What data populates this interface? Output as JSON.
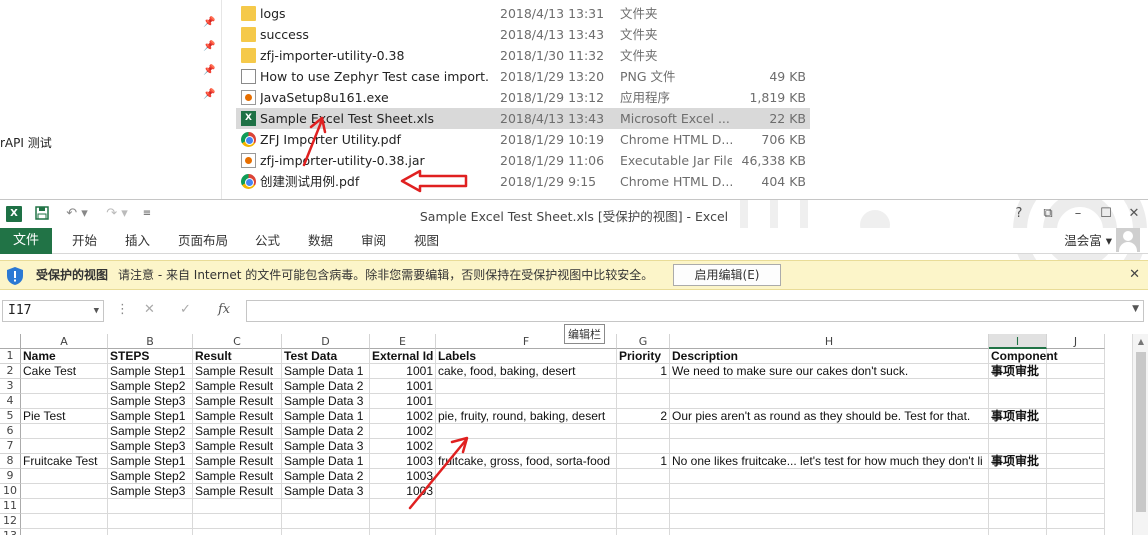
{
  "explorer": {
    "nav_label": "rAPI 测试",
    "files": [
      {
        "name": "logs",
        "date": "2018/4/13 13:31",
        "type": "文件夹",
        "size": "",
        "icon": "folder-icon"
      },
      {
        "name": "success",
        "date": "2018/4/13 13:43",
        "type": "文件夹",
        "size": "",
        "icon": "folder-icon"
      },
      {
        "name": "zfj-importer-utility-0.38",
        "date": "2018/1/30 11:32",
        "type": "文件夹",
        "size": "",
        "icon": "folder-icon"
      },
      {
        "name": "How to use Zephyr Test case import...",
        "date": "2018/1/29 13:20",
        "type": "PNG 文件",
        "size": "49 KB",
        "icon": "png-file-icon"
      },
      {
        "name": "JavaSetup8u161.exe",
        "date": "2018/1/29 13:12",
        "type": "应用程序",
        "size": "1,819 KB",
        "icon": "java-setup-icon"
      },
      {
        "name": "Sample Excel Test Sheet.xls",
        "date": "2018/4/13 13:43",
        "type": "Microsoft Excel ...",
        "size": "22 KB",
        "icon": "excel-file-icon"
      },
      {
        "name": "ZFJ Importer Utility.pdf",
        "date": "2018/1/29 10:19",
        "type": "Chrome HTML D...",
        "size": "706 KB",
        "icon": "chrome-pdf-icon"
      },
      {
        "name": "zfj-importer-utility-0.38.jar",
        "date": "2018/1/29 11:06",
        "type": "Executable Jar File",
        "size": "46,338 KB",
        "icon": "jar-file-icon"
      },
      {
        "name": "创建测试用例.pdf",
        "date": "2018/1/29 9:15",
        "type": "Chrome HTML D...",
        "size": "404 KB",
        "icon": "chrome-pdf-icon"
      }
    ]
  },
  "excel": {
    "title": "Sample Excel Test Sheet.xls  [受保护的视图] - Excel",
    "window_buttons": {
      "help": "?",
      "restore_ribbon": "⧉",
      "minimize": "–",
      "maximize": "☐",
      "close": "✕"
    },
    "ribbon_tabs": [
      "文件",
      "开始",
      "插入",
      "页面布局",
      "公式",
      "数据",
      "审阅",
      "视图"
    ],
    "user_name": "温会富",
    "protected_view": {
      "title": "受保护的视图",
      "message": "请注意 - 来自 Internet 的文件可能包含病毒。除非您需要编辑，否则保持在受保护视图中比较安全。",
      "button": "启用编辑(E)",
      "close": "✕"
    },
    "name_box": "I17",
    "formula_tooltip": "编辑栏",
    "fx_label": "fx",
    "columns": [
      "A",
      "B",
      "C",
      "D",
      "E",
      "F",
      "G",
      "H",
      "I",
      "J"
    ],
    "rows": [
      [
        "Name",
        "STEPS",
        "Result",
        "Test Data",
        "External Id",
        "Labels",
        "Priority",
        "Description",
        "Component",
        ""
      ],
      [
        "Cake Test",
        "Sample Step1",
        "Sample Result",
        "Sample Data 1",
        "1001",
        "cake, food, baking, desert",
        "1",
        "We need to make sure our cakes don't suck.",
        "事项审批",
        ""
      ],
      [
        "",
        "Sample Step2",
        "Sample Result",
        "Sample Data 2",
        "1001",
        "",
        "",
        "",
        "",
        ""
      ],
      [
        "",
        "Sample Step3",
        "Sample Result",
        "Sample Data 3",
        "1001",
        "",
        "",
        "",
        "",
        ""
      ],
      [
        "Pie Test",
        "Sample Step1",
        "Sample Result",
        "Sample Data 1",
        "1002",
        "pie, fruity, round, baking, desert",
        "2",
        "Our pies aren't as round as they should be. Test for that.",
        "事项审批",
        ""
      ],
      [
        "",
        "Sample Step2",
        "Sample Result",
        "Sample Data 2",
        "1002",
        "",
        "",
        "",
        "",
        ""
      ],
      [
        "",
        "Sample Step3",
        "Sample Result",
        "Sample Data 3",
        "1002",
        "",
        "",
        "",
        "",
        ""
      ],
      [
        "Fruitcake Test",
        "Sample Step1",
        "Sample Result",
        "Sample Data 1",
        "1003",
        "fruitcake, gross, food, sorta-food",
        "1",
        "No one likes fruitcake... let's test for how much they don't li",
        "事项审批",
        ""
      ],
      [
        "",
        "Sample Step2",
        "Sample Result",
        "Sample Data 2",
        "1003",
        "",
        "",
        "",
        "",
        ""
      ],
      [
        "",
        "Sample Step3",
        "Sample Result",
        "Sample Data 3",
        "1003",
        "",
        "",
        "",
        "",
        ""
      ],
      [
        "",
        "",
        "",
        "",
        "",
        "",
        "",
        "",
        "",
        ""
      ],
      [
        "",
        "",
        "",
        "",
        "",
        "",
        "",
        "",
        "",
        ""
      ],
      [
        "",
        "",
        "",
        "",
        "",
        "",
        "",
        "",
        "",
        ""
      ]
    ],
    "active_column": "I",
    "colors": {
      "excel_green": "#217346",
      "protected_bar": "#fcf5c9",
      "annotation_red": "#e02020"
    }
  }
}
